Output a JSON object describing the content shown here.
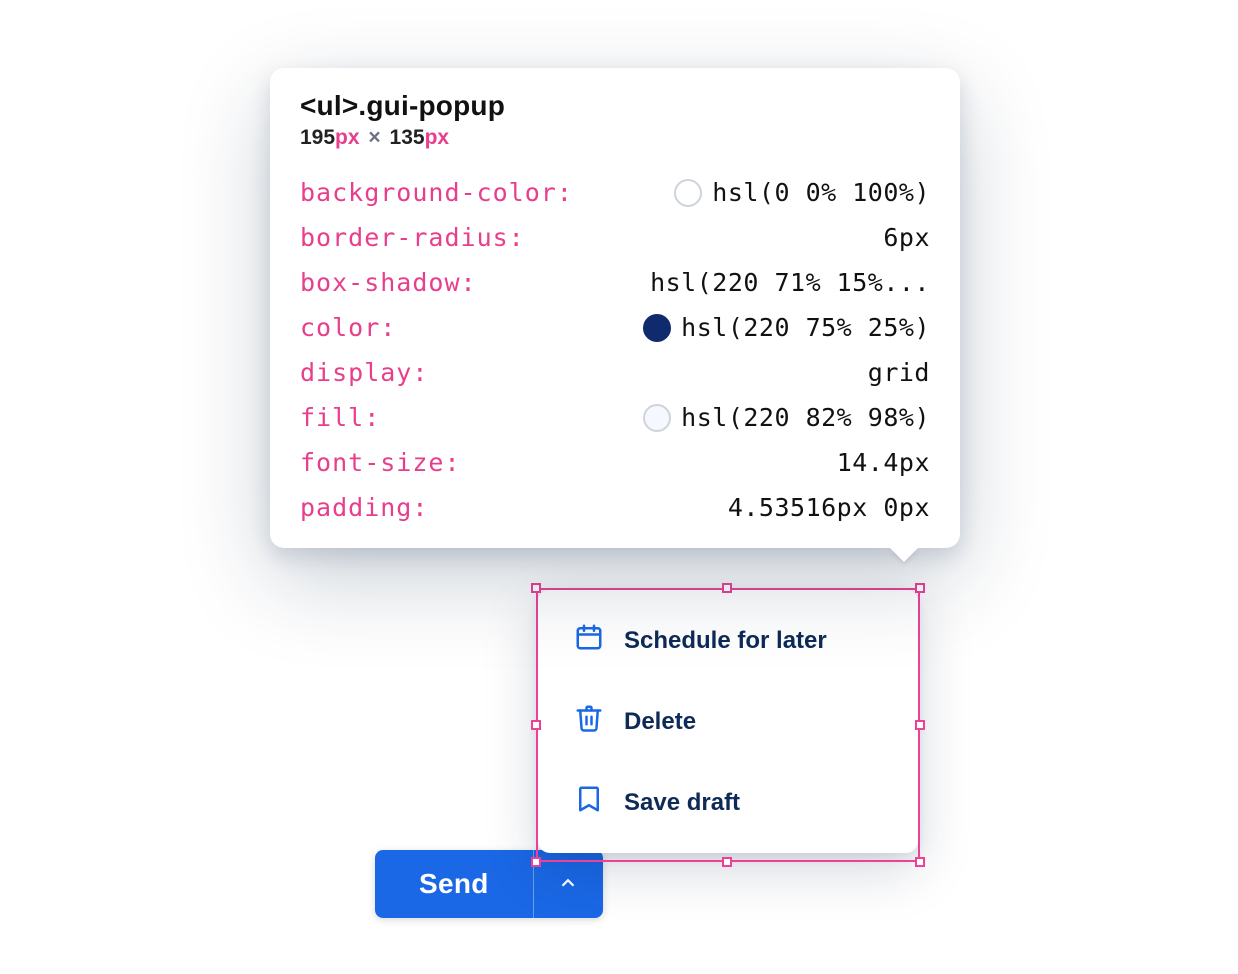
{
  "send": {
    "label": "Send"
  },
  "popup": {
    "items": [
      {
        "label": "Schedule for later",
        "icon": "calendar-icon"
      },
      {
        "label": "Delete",
        "icon": "trash-icon"
      },
      {
        "label": "Save draft",
        "icon": "bookmark-icon"
      }
    ]
  },
  "tooltip": {
    "selector_tag": "<ul>",
    "selector_class": ".gui-popup",
    "dims": {
      "w": "195",
      "h": "135",
      "unit": "px"
    },
    "props": [
      {
        "name": "background-color",
        "value": "hsl(0 0% 100%)",
        "swatch": "#ffffff"
      },
      {
        "name": "border-radius",
        "value": "6px"
      },
      {
        "name": "box-shadow",
        "value": "hsl(220 71% 15%..."
      },
      {
        "name": "color",
        "value": "hsl(220 75% 25%)",
        "swatch": "#102a6e"
      },
      {
        "name": "display",
        "value": "grid"
      },
      {
        "name": "fill",
        "value": "hsl(220 82% 98%)",
        "swatch": "#f5f8fe"
      },
      {
        "name": "font-size",
        "value": "14.4px"
      },
      {
        "name": "padding",
        "value": "4.53516px 0px"
      }
    ]
  }
}
